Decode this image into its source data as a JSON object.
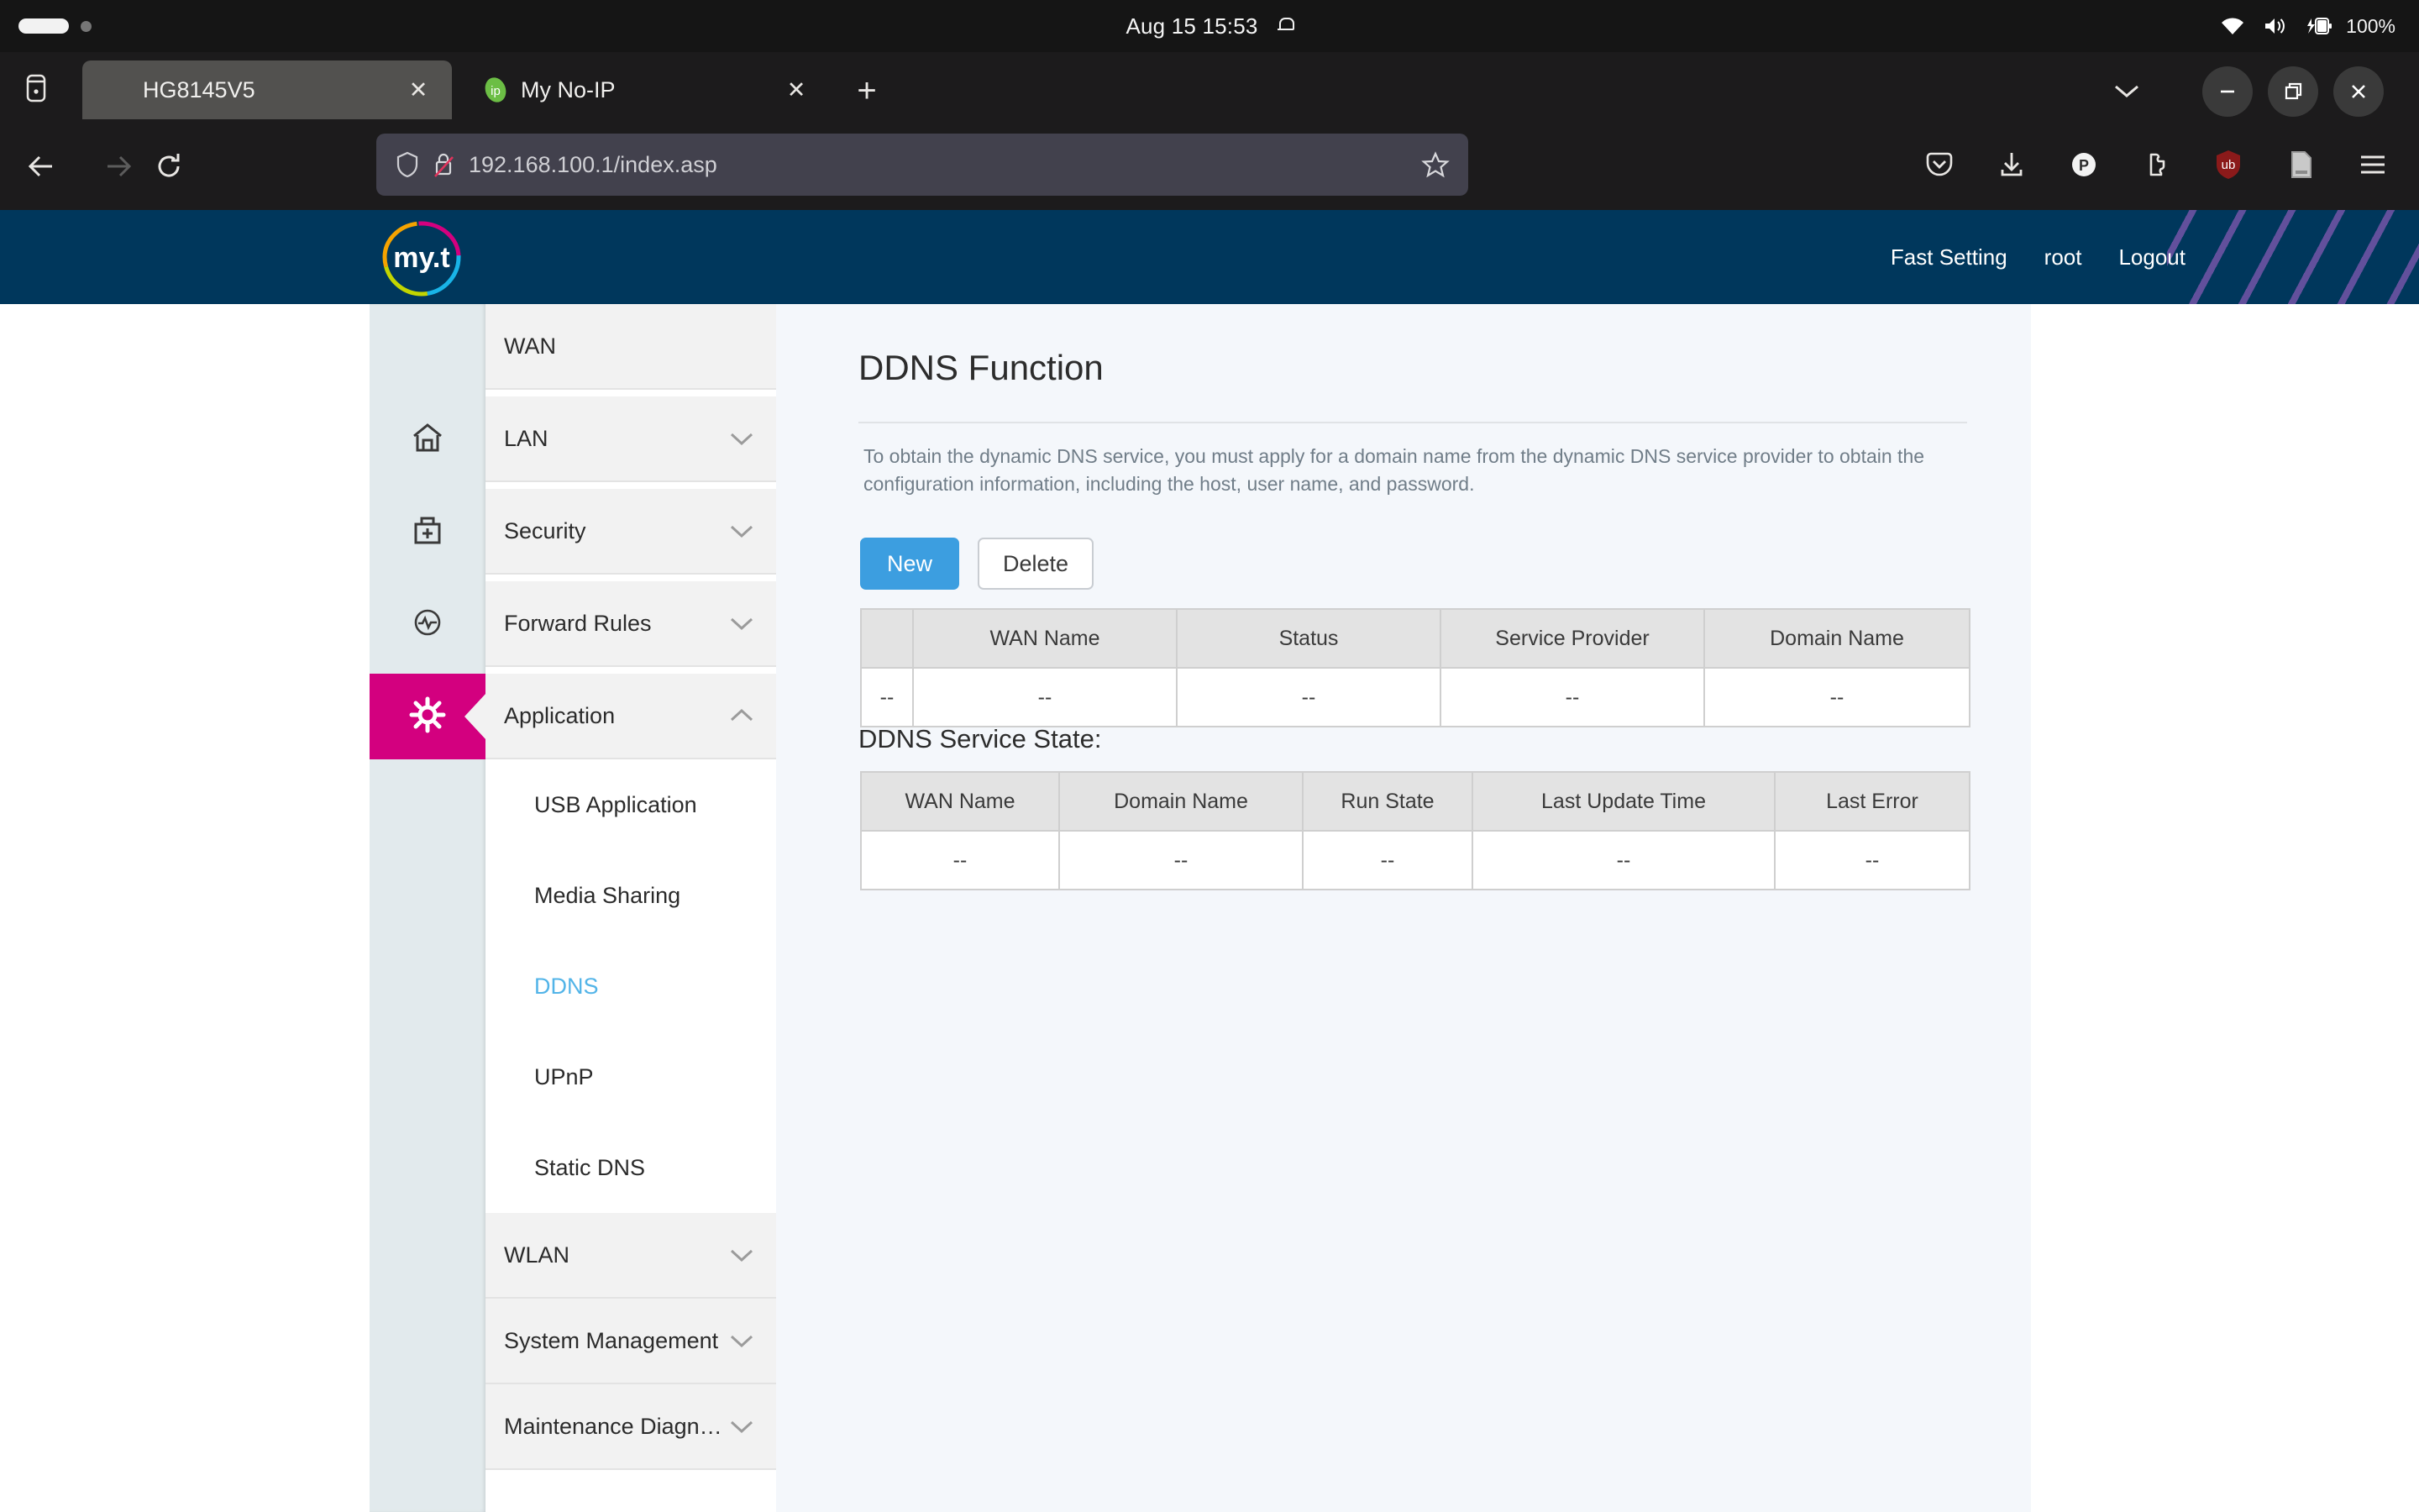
{
  "os_bar": {
    "clock": "Aug 15  15:53",
    "battery_percent": "100%",
    "icons": [
      "wifi-icon",
      "volume-icon",
      "battery-icon",
      "bell-icon"
    ]
  },
  "browser": {
    "tabs": [
      {
        "title": "HG8145V5",
        "favicon": "none",
        "active": true,
        "close_label": "✕"
      },
      {
        "title": "My No-IP",
        "favicon": "noip-icon",
        "active": false,
        "close_label": "✕"
      }
    ],
    "new_tab_label": "+",
    "url": "192.168.100.1/index.asp",
    "toolbar_icons": [
      "pocket-icon",
      "download-icon",
      "proton-pass-icon",
      "extensions-puzzle-icon",
      "ublock-origin-icon",
      "reader-mode-icon",
      "app-menu-icon"
    ],
    "window_controls": {
      "minimize": "–",
      "maximize": "❐",
      "close": "✕"
    }
  },
  "router": {
    "brand": "my.t",
    "header_links": [
      {
        "label": "Fast Setting"
      },
      {
        "label": "root"
      },
      {
        "label": "Logout"
      }
    ],
    "sidebar": {
      "items": [
        {
          "label": "WAN",
          "icon": "none",
          "expandable": false,
          "expanded": false,
          "active": false
        },
        {
          "label": "LAN",
          "icon": "home-icon",
          "expandable": true,
          "expanded": false,
          "active": false
        },
        {
          "label": "Security",
          "icon": "first-aid-kit-icon",
          "expandable": true,
          "expanded": false,
          "active": false
        },
        {
          "label": "Forward Rules",
          "icon": "pulse-circle-icon",
          "expandable": true,
          "expanded": false,
          "active": false
        },
        {
          "label": "Application",
          "icon": "gear-icon",
          "expandable": true,
          "expanded": true,
          "active": true
        },
        {
          "label": "WLAN",
          "icon": "none",
          "expandable": true,
          "expanded": false,
          "active": false
        },
        {
          "label": "System Management",
          "icon": "none",
          "expandable": true,
          "expanded": false,
          "active": false
        },
        {
          "label": "Maintenance Diagno...",
          "icon": "none",
          "expandable": true,
          "expanded": false,
          "active": false
        }
      ],
      "sub_items": [
        {
          "label": "USB Application",
          "active": false
        },
        {
          "label": "Media Sharing",
          "active": false
        },
        {
          "label": "DDNS",
          "active": true
        },
        {
          "label": "UPnP",
          "active": false
        },
        {
          "label": "Static DNS",
          "active": false
        }
      ]
    },
    "content": {
      "title": "DDNS Function",
      "intro": "To obtain the dynamic DNS service, you must apply for a domain name from the dynamic DNS service provider to obtain the configuration information, including the host, user name, and password.",
      "buttons": {
        "new": "New",
        "delete": "Delete"
      },
      "ddns_table": {
        "headers": [
          "",
          "WAN Name",
          "Status",
          "Service Provider",
          "Domain Name"
        ],
        "rows": [
          [
            "--",
            "--",
            "--",
            "--",
            "--"
          ]
        ]
      },
      "state_heading": "DDNS Service State:",
      "state_table": {
        "headers": [
          "WAN Name",
          "Domain Name",
          "Run State",
          "Last Update Time",
          "Last Error"
        ],
        "rows": [
          [
            "--",
            "--",
            "--",
            "--",
            "--"
          ]
        ]
      }
    }
  },
  "colors": {
    "brand_navy": "#00375c",
    "accent_magenta": "#d3007f",
    "accent_blue": "#3c9ee0",
    "active_link_blue": "#52b4e8"
  }
}
